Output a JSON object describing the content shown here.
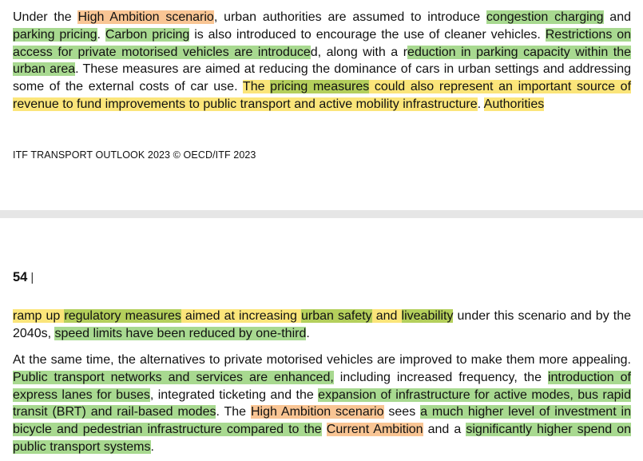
{
  "page_top": {
    "paragraph": [
      {
        "t": "Under the ",
        "h": ""
      },
      {
        "t": "High Ambition scenario",
        "h": "o"
      },
      {
        "t": ", urban authorities are assumed to introduce ",
        "h": ""
      },
      {
        "t": "congestion charging",
        "h": "g"
      },
      {
        "t": " and ",
        "h": ""
      },
      {
        "t": "parking pricing",
        "h": "g"
      },
      {
        "t": ". ",
        "h": ""
      },
      {
        "t": "Carbon pricing",
        "h": "g"
      },
      {
        "t": " is also introduced to encourage the use of cleaner vehicles. ",
        "h": ""
      },
      {
        "t": "Restrictions on access for private motorised vehicles are introduce",
        "h": "g"
      },
      {
        "t": "d, along with a r",
        "h": ""
      },
      {
        "t": "eduction in parking capacity within the urban area",
        "h": "g"
      },
      {
        "t": ". These measures are aimed at reducing the dominance of cars in urban settings and addressing some of the external costs of car use. ",
        "h": ""
      },
      {
        "t": "The ",
        "h": "y"
      },
      {
        "t": "pricing measures",
        "h": "gy"
      },
      {
        "t": " could also represent an important source of revenue to fund improvements to public transport and active mobility infrastructure",
        "h": "y"
      },
      {
        "t": ". ",
        "h": ""
      },
      {
        "t": "Authorities",
        "h": "y"
      }
    ],
    "footer": "ITF TRANSPORT OUTLOOK 2023 © OECD/ITF 2023"
  },
  "page_bottom": {
    "page_number": "54",
    "page_number_separator": "|",
    "paragraph_1": [
      {
        "t": "ramp up ",
        "h": "y"
      },
      {
        "t": "regulatory measures",
        "h": "gy"
      },
      {
        "t": " aimed at increasing ",
        "h": "y"
      },
      {
        "t": "urban safety",
        "h": "gy"
      },
      {
        "t": " and ",
        "h": "y"
      },
      {
        "t": "liveability",
        "h": "gy"
      },
      {
        "t": " under this scenario and by the 2040s, ",
        "h": ""
      },
      {
        "t": "speed limits have been reduced by one-third",
        "h": "g"
      },
      {
        "t": ".",
        "h": ""
      }
    ],
    "paragraph_2": [
      {
        "t": "At the same time, the alternatives to private motorised vehicles are improved to make them more appealing. ",
        "h": ""
      },
      {
        "t": "Public transport networks and services are enhanced,",
        "h": "g"
      },
      {
        "t": " including increased frequency, the ",
        "h": ""
      },
      {
        "t": "introduction of express lanes for buses",
        "h": "g"
      },
      {
        "t": ", integrated ticketing and the ",
        "h": ""
      },
      {
        "t": "expansion of infrastructure for active modes, bus rapid transit (BRT) and rail-based modes",
        "h": "g"
      },
      {
        "t": ". The ",
        "h": ""
      },
      {
        "t": "High Ambition scenario",
        "h": "o"
      },
      {
        "t": " sees ",
        "h": ""
      },
      {
        "t": "a much higher level of investment in bicycle and pedestrian infrastructure compared to the",
        "h": "g"
      },
      {
        "t": " ",
        "h": ""
      },
      {
        "t": "Current Ambition",
        "h": "o"
      },
      {
        "t": " and a ",
        "h": ""
      },
      {
        "t": "significantly higher spend on public transport systems",
        "h": "g"
      },
      {
        "t": ".",
        "h": ""
      }
    ]
  },
  "highlight_colors": {
    "g": "#a8d990",
    "o": "#f9c594",
    "y": "#fbe57a",
    "gy": "#b4cf5c"
  }
}
